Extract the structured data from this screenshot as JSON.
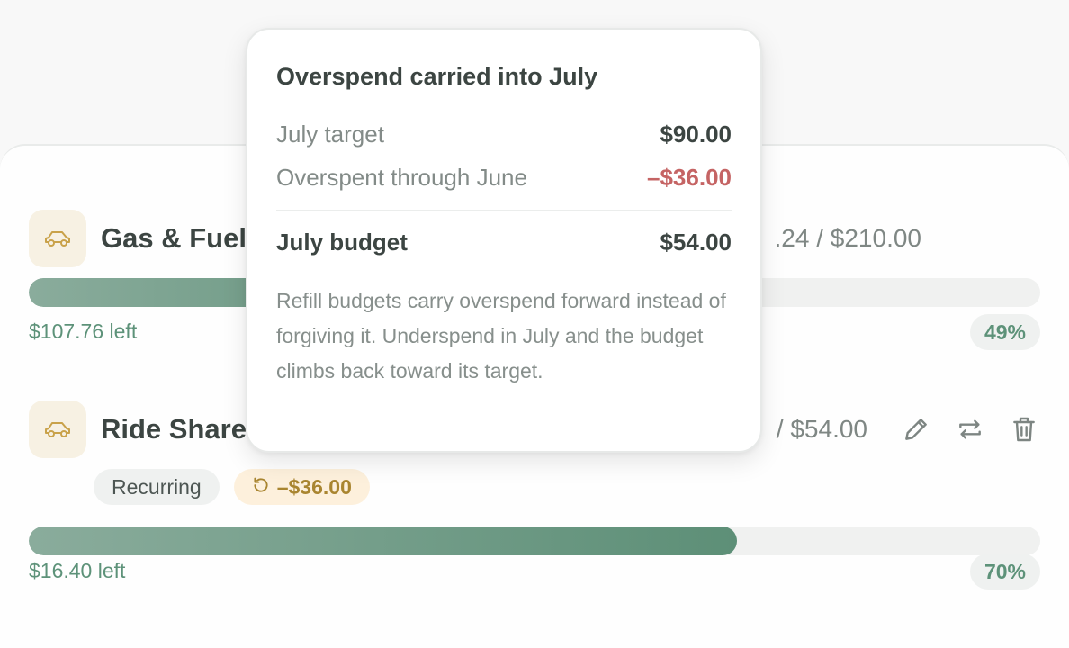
{
  "categories": [
    {
      "name": "Gas & Fuel",
      "icon": "car-icon",
      "amount": ".24 / $210.00",
      "progress_fraction": 0.49,
      "left": "$107.76 left",
      "percent": "49%"
    },
    {
      "name": "Ride Share",
      "icon": "car-icon",
      "amount": "/ $54.00",
      "tags": {
        "recurring": "Recurring",
        "rollover": "–$36.00",
        "rollover_icon": "rollover-icon"
      },
      "actions": [
        "edit-icon",
        "repeat-icon",
        "trash-icon"
      ],
      "progress_fraction": 0.7,
      "left": "$16.40 left",
      "percent": "70%"
    }
  ],
  "popover": {
    "title": "Overspend carried into July",
    "lines": [
      {
        "label": "July target",
        "value": "$90.00"
      },
      {
        "label": "Overspent through June",
        "value": "–$36.00"
      },
      {
        "label": "July budget",
        "value": "$54.00"
      }
    ],
    "note": "Refill budgets carry overspend forward instead of forgiving it. Underspend in July and the budget climbs back toward its target."
  },
  "colors": {
    "accent": "#5d9279",
    "bar_start": "#8aac9c",
    "bar_end": "#5d8f77",
    "negative": "#c56464",
    "rollover_text": "#a98530",
    "icon_bg": "#f7f1e3",
    "icon_stroke": "#c9a24a"
  }
}
